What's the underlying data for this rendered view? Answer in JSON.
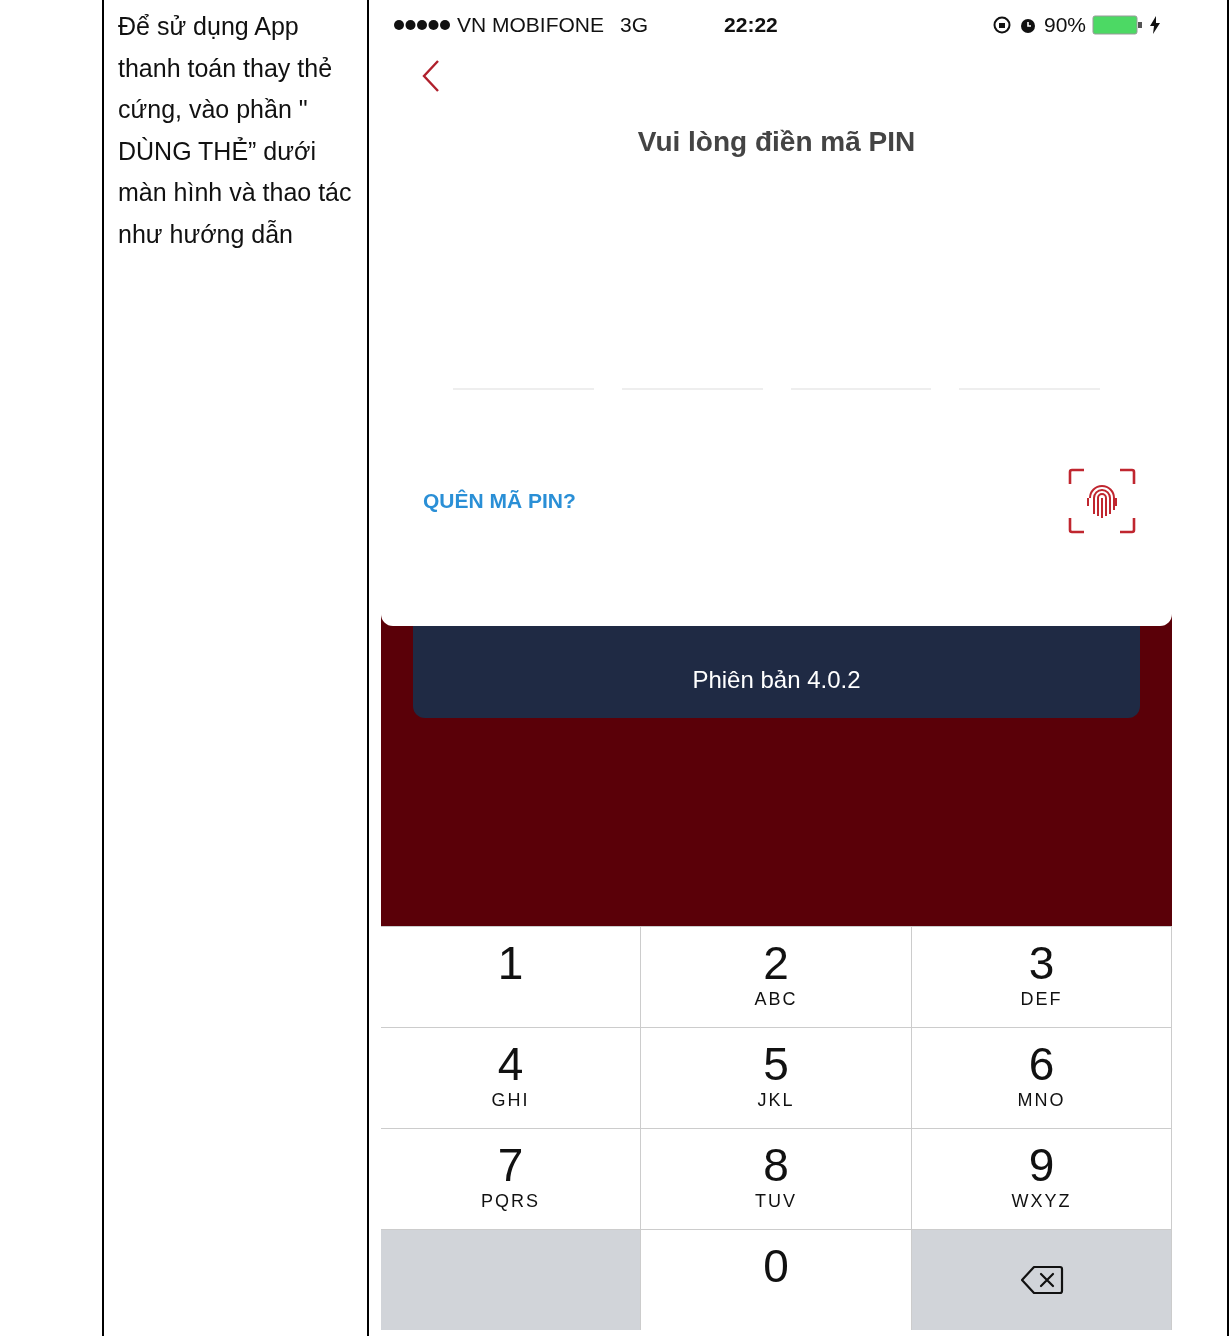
{
  "instruction": "Để sử dụng App thanh toán thay thẻ cứng, vào phần \" DÙNG THẺ” dưới màn hình và thao tác như hướng dẫn",
  "phone": {
    "status_bar": {
      "carrier": "VN MOBIFONE",
      "network": "3G",
      "time": "22:22",
      "battery": "90%"
    },
    "title": "Vui lòng điền mã PIN",
    "pin_slots": [
      {
        "filled": false
      },
      {
        "filled": false
      },
      {
        "filled": false
      },
      {
        "filled": false
      }
    ],
    "forgot_link": "QUÊN MÃ PIN?",
    "version": "Phiên bản 4.0.2",
    "keypad": [
      {
        "kind": "digit",
        "digit": "1"
      },
      {
        "kind": "digit",
        "digit": "2",
        "letters": "ABC"
      },
      {
        "kind": "digit",
        "digit": "3",
        "letters": "DEF"
      },
      {
        "kind": "digit",
        "digit": "4",
        "letters": "GHI"
      },
      {
        "kind": "digit",
        "digit": "5",
        "letters": "JKL"
      },
      {
        "kind": "digit",
        "digit": "6",
        "letters": "MNO"
      },
      {
        "kind": "digit",
        "digit": "7",
        "letters": "PQRS"
      },
      {
        "kind": "digit",
        "digit": "8",
        "letters": "TUV"
      },
      {
        "kind": "digit",
        "digit": "9",
        "letters": "WXYZ"
      },
      {
        "kind": "blank"
      },
      {
        "kind": "digit",
        "digit": "0"
      },
      {
        "kind": "backspace"
      }
    ]
  }
}
